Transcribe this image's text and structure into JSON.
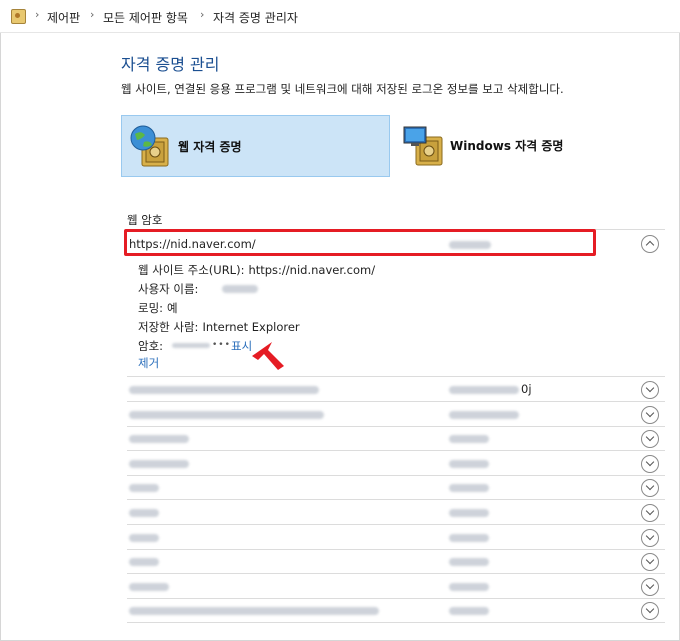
{
  "breadcrumb": {
    "icon": "control-panel-icon",
    "items": [
      "제어판",
      "모든 제어판 항목",
      "자격 증명 관리자"
    ],
    "separator": "›"
  },
  "header": {
    "title": "자격 증명 관리",
    "description": "웹 사이트, 연결된 응용 프로그램 및 네트워크에 대해 저장된 로그온 정보를 보고 삭제합니다."
  },
  "credential_types": [
    {
      "label": "웹 자격 증명",
      "icon": "web-credential-vault-icon",
      "selected": true
    },
    {
      "label": "Windows 자격 증명",
      "icon": "windows-credential-vault-icon",
      "selected": false
    }
  ],
  "web_passwords": {
    "section_label": "웹 암호",
    "expanded": {
      "url": "https://nid.naver.com/",
      "details": {
        "site_label": "웹 사이트 주소(URL):",
        "site_value": "https://nid.naver.com/",
        "user_label": "사용자 이름:",
        "roaming_label": "로밍:",
        "roaming_value": "예",
        "saved_by_label": "저장한 사람:",
        "saved_by_value": "Internet Explorer",
        "password_label": "암호:",
        "password_mask": "•••",
        "show_link": "표시",
        "remove_link": "제거"
      }
    },
    "collapsed_rows": [
      {
        "trailing_text": "0j"
      },
      {
        "trailing_text": ""
      },
      {
        "trailing_text": ""
      },
      {
        "trailing_text": ""
      },
      {
        "trailing_text": ""
      },
      {
        "trailing_text": ""
      },
      {
        "trailing_text": ""
      },
      {
        "trailing_text": ""
      },
      {
        "trailing_text": ""
      },
      {
        "trailing_text": ""
      }
    ]
  },
  "colors": {
    "title": "#1b4f91",
    "selected_tile": "#cce4f7",
    "link": "#2a6ebb",
    "highlight_box": "#e51c24"
  }
}
